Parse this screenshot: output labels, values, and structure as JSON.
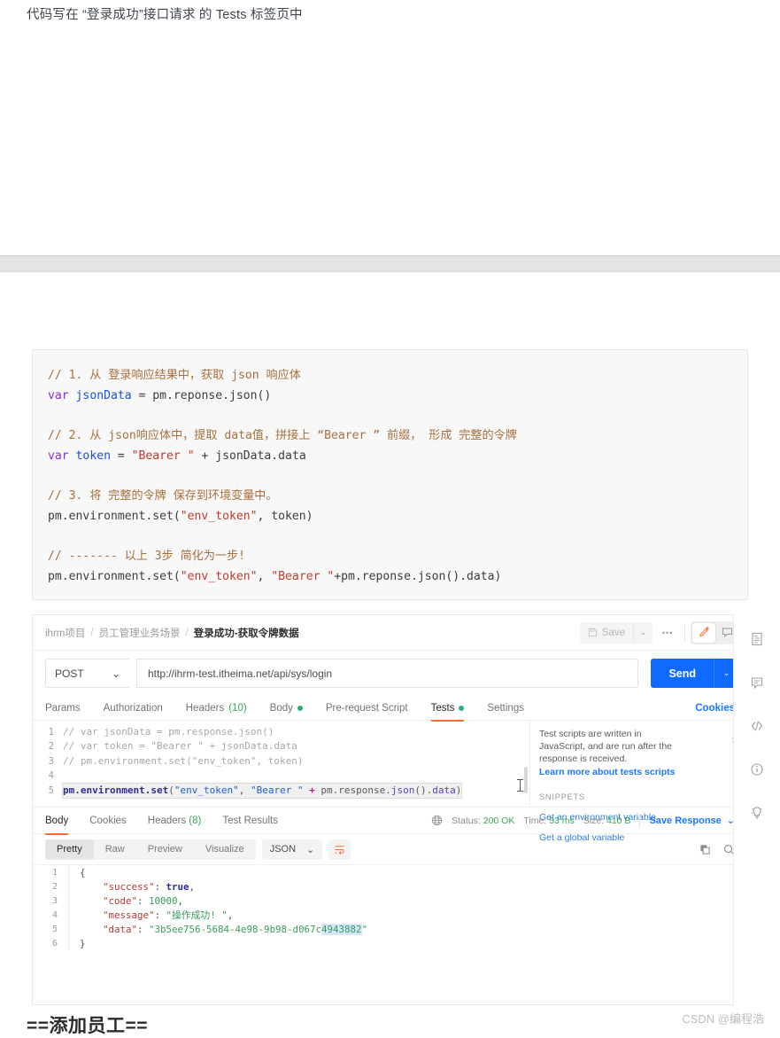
{
  "doc": {
    "heading": "代码写在 “登录成功”接口请求 的 Tests 标签页中",
    "bottom_heading": "==添加员工==",
    "watermark": "CSDN @编程浩"
  },
  "code_block": {
    "lines": [
      {
        "type": "comment",
        "text": "// 1. 从 登录响应结果中，获取 json 响应体"
      },
      {
        "type": "code",
        "text": "var jsonData = pm.reponse.json()"
      },
      {
        "type": "blank",
        "text": ""
      },
      {
        "type": "comment",
        "text": "// 2. 从 json响应体中，提取 data值，拼接上 “Bearer ” 前缀， 形成 完整的令牌"
      },
      {
        "type": "code",
        "text": "var token = \"Bearer \" + jsonData.data"
      },
      {
        "type": "blank",
        "text": ""
      },
      {
        "type": "comment",
        "text": "// 3. 将 完整的令牌 保存到环境变量中。"
      },
      {
        "type": "code",
        "text": "pm.environment.set(\"env_token\", token)"
      },
      {
        "type": "blank",
        "text": ""
      },
      {
        "type": "comment",
        "text": "// ------- 以上 3步 简化为一步!"
      },
      {
        "type": "code",
        "text": "pm.environment.set(\"env_token\", \"Bearer \"+pm.reponse.json().data)"
      }
    ]
  },
  "postman": {
    "breadcrumb": {
      "workspace": "ihrm项目",
      "collection": "员工管理业务场景",
      "separator": "/",
      "current": "登录成功-获取令牌数据"
    },
    "actions": {
      "save_label": "Save",
      "save_caret": "⌄",
      "more_label": "•••",
      "edit_icon": "pencil-icon",
      "comment_icon": "comment-icon"
    },
    "request": {
      "method": "POST",
      "method_caret": "⌄",
      "url": "http://ihrm-test.itheima.net/api/sys/login",
      "send_label": "Send",
      "send_caret": "⌄"
    },
    "request_tabs": [
      {
        "label": "Params",
        "count": "",
        "dot": false,
        "active": false
      },
      {
        "label": "Authorization",
        "count": "",
        "dot": false,
        "active": false
      },
      {
        "label": "Headers",
        "count": "(10)",
        "dot": false,
        "active": false
      },
      {
        "label": "Body",
        "count": "",
        "dot": true,
        "active": false
      },
      {
        "label": "Pre-request Script",
        "count": "",
        "dot": false,
        "active": false
      },
      {
        "label": "Tests",
        "count": "",
        "dot": true,
        "active": true
      },
      {
        "label": "Settings",
        "count": "",
        "dot": false,
        "active": false
      }
    ],
    "cookies_link": "Cookies",
    "editor": {
      "lines": [
        {
          "n": "1",
          "text": "// var jsonData = pm.response.json()",
          "comment": true
        },
        {
          "n": "2",
          "text": "// var token = \"Bearer \" + jsonData.data",
          "comment": true
        },
        {
          "n": "3",
          "text": "// pm.environment.set(\"env_token\", token)",
          "comment": true
        },
        {
          "n": "4",
          "text": "",
          "comment": false
        },
        {
          "n": "5",
          "text": "pm.environment.set(\"env_token\", \"Bearer \" + pm.response.json().data)",
          "comment": false
        }
      ]
    },
    "snippets": {
      "description": "Test scripts are written in JavaScript, and are run after the response is received.",
      "learn_more": "Learn more about tests scripts",
      "title": "SNIPPETS",
      "items": [
        "Get an environment variable",
        "Get a global variable"
      ],
      "chevron": "›"
    },
    "response_tabs": [
      {
        "label": "Body",
        "count": "",
        "active": true
      },
      {
        "label": "Cookies",
        "count": "",
        "active": false
      },
      {
        "label": "Headers",
        "count": "(8)",
        "active": false
      },
      {
        "label": "Test Results",
        "count": "",
        "active": false
      }
    ],
    "response_meta": {
      "globe_icon": "globe-icon",
      "status_label": "Status:",
      "status_value": "200 OK",
      "time_label": "Time:",
      "time_value": "53 ms",
      "size_label": "Size:",
      "size_value": "410 B",
      "save_response": "Save Response",
      "save_caret": "⌄"
    },
    "format_bar": {
      "views": [
        "Pretty",
        "Raw",
        "Preview",
        "Visualize"
      ],
      "active_view": "Pretty",
      "language": "JSON",
      "language_caret": "⌄",
      "wrap_icon": "word-wrap-icon",
      "copy_icon": "copy-icon",
      "search_icon": "search-icon"
    },
    "response_body": [
      {
        "n": "1",
        "segments": [
          {
            "t": "{",
            "c": "jpun"
          }
        ]
      },
      {
        "n": "2",
        "segments": [
          {
            "t": "    \"success\"",
            "c": "jkey"
          },
          {
            "t": ": ",
            "c": "jpun"
          },
          {
            "t": "true",
            "c": "jbool"
          },
          {
            "t": ",",
            "c": "jpun"
          }
        ]
      },
      {
        "n": "3",
        "segments": [
          {
            "t": "    \"code\"",
            "c": "jkey"
          },
          {
            "t": ": ",
            "c": "jpun"
          },
          {
            "t": "10000",
            "c": "jnum2"
          },
          {
            "t": ",",
            "c": "jpun"
          }
        ]
      },
      {
        "n": "4",
        "segments": [
          {
            "t": "    \"message\"",
            "c": "jkey"
          },
          {
            "t": ": ",
            "c": "jpun"
          },
          {
            "t": "\"操作成功! \"",
            "c": "jstr"
          },
          {
            "t": ",",
            "c": "jpun"
          }
        ]
      },
      {
        "n": "5",
        "segments": [
          {
            "t": "    \"data\"",
            "c": "jkey"
          },
          {
            "t": ": ",
            "c": "jpun"
          },
          {
            "t": "\"3b5ee756-5684-4e98-9b98-d067c4943882\"",
            "c": "jstr"
          }
        ]
      },
      {
        "n": "6",
        "segments": [
          {
            "t": "}",
            "c": "jpun"
          }
        ]
      }
    ],
    "rail_icons": [
      "document-icon",
      "comment-icon",
      "code-icon",
      "info-icon",
      "bulb-icon"
    ]
  },
  "colors": {
    "accent_orange": "#ff6c37",
    "link_blue": "#1b76ff",
    "send_blue": "#0f6bff",
    "status_green": "#3aa757"
  }
}
